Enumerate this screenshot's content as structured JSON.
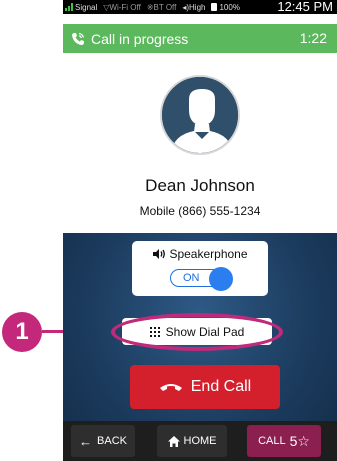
{
  "status_bar": {
    "signal": "Signal",
    "wifi": "Wi-Fi Off",
    "bt": "BT Off",
    "volume": "High",
    "battery": "100%",
    "time": "12:45 PM"
  },
  "call_bar": {
    "title": "Call in progress",
    "timer": "1:22"
  },
  "contact": {
    "name": "Dean Johnson",
    "number": "Mobile (866) 555-1234"
  },
  "speakerphone": {
    "label": "Speakerphone",
    "state": "ON"
  },
  "dial_pad_button": "Show Dial Pad",
  "end_call_button": "End Call",
  "nav": {
    "back": "BACK",
    "home": "HOME",
    "call": "CALL",
    "call_badge": "5☆"
  },
  "callout": "1",
  "colors": {
    "call_bar": "#5cb85c",
    "end_call": "#d41f2c",
    "highlight": "#c4287a",
    "toggle_blue": "#2a7ef0",
    "panel_bg": "#1b3a5c"
  }
}
